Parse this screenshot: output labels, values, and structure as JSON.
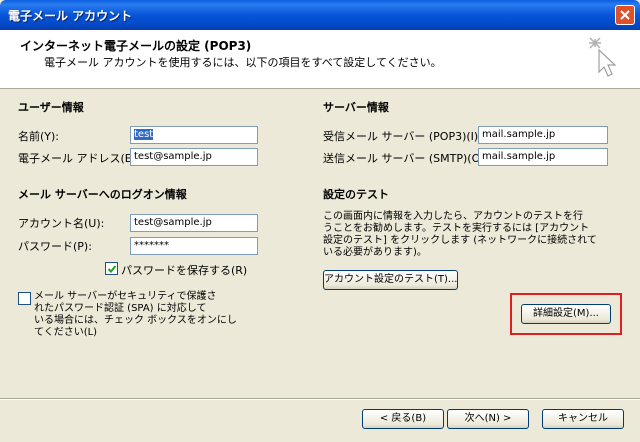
{
  "window": {
    "title": "電子メール アカウント"
  },
  "header": {
    "title": "インターネット電子メールの設定 (POP3)",
    "subtitle": "電子メール アカウントを使用するには、以下の項目をすべて設定してください。"
  },
  "user_info": {
    "section_title": "ユーザー情報",
    "name_label": "名前(Y):",
    "name_value": "test",
    "email_label": "電子メール アドレス(E):",
    "email_value": "test@sample.jp"
  },
  "logon_info": {
    "section_title": "メール サーバーへのログオン情報",
    "account_label": "アカウント名(U):",
    "account_value": "test@sample.jp",
    "password_label": "パスワード(P):",
    "password_value": "*******",
    "save_password_label": "パスワードを保存する(R)",
    "save_password_checked": true,
    "spa_lines": [
      "メール サーバーがセキュリティで保護さ",
      "れたパスワード認証 (SPA) に対応して",
      "いる場合には、チェック ボックスをオンにし",
      "てください(L)"
    ],
    "spa_checked": false
  },
  "server_info": {
    "section_title": "サーバー情報",
    "incoming_label": "受信メール サーバー (POP3)(I):",
    "incoming_value": "mail.sample.jp",
    "outgoing_label": "送信メール サーバー (SMTP)(O):",
    "outgoing_value": "mail.sample.jp"
  },
  "test_settings": {
    "section_title": "設定のテスト",
    "description_lines": [
      "この画面内に情報を入力したら、アカウントのテストを行",
      "うことをお勧めします。テストを実行するには [アカウント",
      "設定のテスト] をクリックします (ネットワークに接続されて",
      "いる必要があります)。"
    ],
    "test_button": "アカウント設定のテスト(T)...",
    "advanced_button": "詳細設定(M)..."
  },
  "footer": {
    "back_button": "< 戻る(B)",
    "next_button": "次へ(N) >",
    "cancel_button": "キャンセル"
  },
  "colors": {
    "highlight": "#e02020",
    "title_bar": "#0655d8",
    "dialog_bg": "#ece9d8"
  }
}
